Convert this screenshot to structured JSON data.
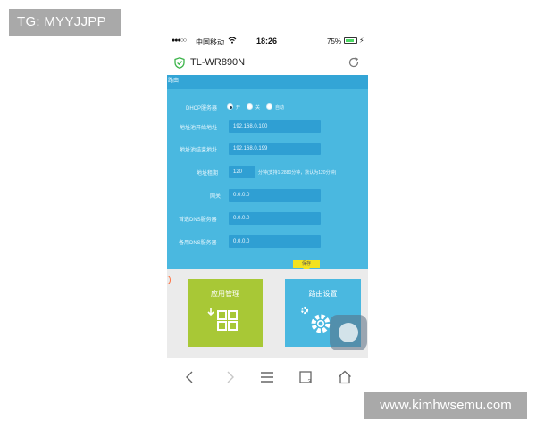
{
  "watermark_top": "TG: MYYJJPP",
  "watermark_bottom": "www.kimhwsemu.com",
  "status_bar": {
    "signal": "●●●○○",
    "carrier": "中国移动",
    "time": "18:26",
    "battery_percent": "75%",
    "battery_level": 0.75
  },
  "app_bar": {
    "title": "TL-WR890N",
    "shield_icon": "shield-check-icon",
    "refresh_icon": "refresh-icon"
  },
  "panel": {
    "corner_text": "路由",
    "dhcp_label": "DHCP服务器",
    "dhcp_options": [
      "开",
      "关",
      "自动"
    ],
    "dhcp_selected": "开",
    "fields": [
      {
        "label": "地址池开始地址",
        "value": "192.168.0.100"
      },
      {
        "label": "地址池结束地址",
        "value": "192.168.0.199"
      },
      {
        "label": "地址租期",
        "value": "120",
        "hint": "分钟(支持1-2880分钟，默认为120分钟)"
      },
      {
        "label": "网关",
        "value": "0.0.0.0"
      },
      {
        "label": "首选DNS服务器",
        "value": "0.0.0.0"
      },
      {
        "label": "备用DNS服务器",
        "value": "0.0.0.0"
      }
    ],
    "save_label": "保存"
  },
  "tiles": [
    {
      "label": "应用管理",
      "icon": "apps-download-icon",
      "color": "#a8c836"
    },
    {
      "label": "路由设置",
      "icon": "gear-settings-icon",
      "color": "#4ab8e0"
    }
  ],
  "nav": {
    "icons": [
      "back-icon",
      "forward-icon",
      "menu-icon",
      "tabs-icon",
      "home-icon"
    ],
    "tabs_count": "3"
  },
  "colors": {
    "panel_blue": "#4ab8e0",
    "field_blue": "#2f9fd3",
    "save_yellow": "#f3e21f",
    "app_green": "#a8c836"
  }
}
